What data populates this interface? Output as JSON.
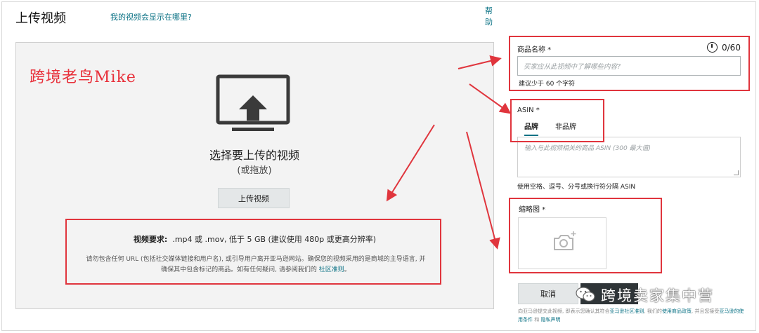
{
  "header": {
    "title": "上传视频",
    "help_link": "我的视频会显示在哪里?",
    "help_side": "帮助"
  },
  "upload_area": {
    "watermark": "跨境老鸟Mike",
    "choose_text": "选择要上传的视频",
    "drag_text": "(或拖放)",
    "upload_button": "上传视频",
    "requirements_label": "视频要求:",
    "requirements_text": ".mp4 或 .mov, 低于 5 GB (建议使用 480p 或更高分辨率)",
    "note_text": "请勿包含任何 URL (包括社交媒体链接和用户名), 或引导用户离开亚马逊网站。确保您的视频采用的是商城的主导语言, 并确保其中包含标记的商品。如有任何疑问, 请参阅我们的",
    "note_link": "社区准则",
    "note_end": "。"
  },
  "form": {
    "product_name": {
      "label": "商品名称 *",
      "counter": "0/60",
      "placeholder": "买家应从此视频中了解哪些内容?",
      "hint": "建议少于 60 个字符"
    },
    "asin": {
      "label": "ASIN *",
      "tabs": [
        "品牌",
        "非品牌"
      ],
      "active_tab": "品牌",
      "placeholder": "输入与此视频相关的商品 ASIN (300 最大值)",
      "hint": "使用空格、逗号、分号或换行符分隔 ASIN"
    },
    "thumbnail": {
      "label": "缩略图 *",
      "icon": "camera-plus-icon"
    },
    "buttons": {
      "cancel": "取消"
    },
    "legal": {
      "text1": "向亚马逊提交此视频, 即表示您确认其符合",
      "link1": "亚马逊社区准则",
      "text2": ", 我们的",
      "link2": "使用商品政策",
      "text3": ", 并且您接受",
      "link3": "亚马逊的使用条件",
      "text4": " 和 ",
      "link4": "隐私声明"
    }
  },
  "overlay": {
    "watermark_bottom": "跨境卖家集中营",
    "wechat_icon": "wechat-icon"
  },
  "colors": {
    "annotation_red": "#e0353d",
    "link_teal": "#0b7285",
    "submit_dark": "#2f3538"
  }
}
